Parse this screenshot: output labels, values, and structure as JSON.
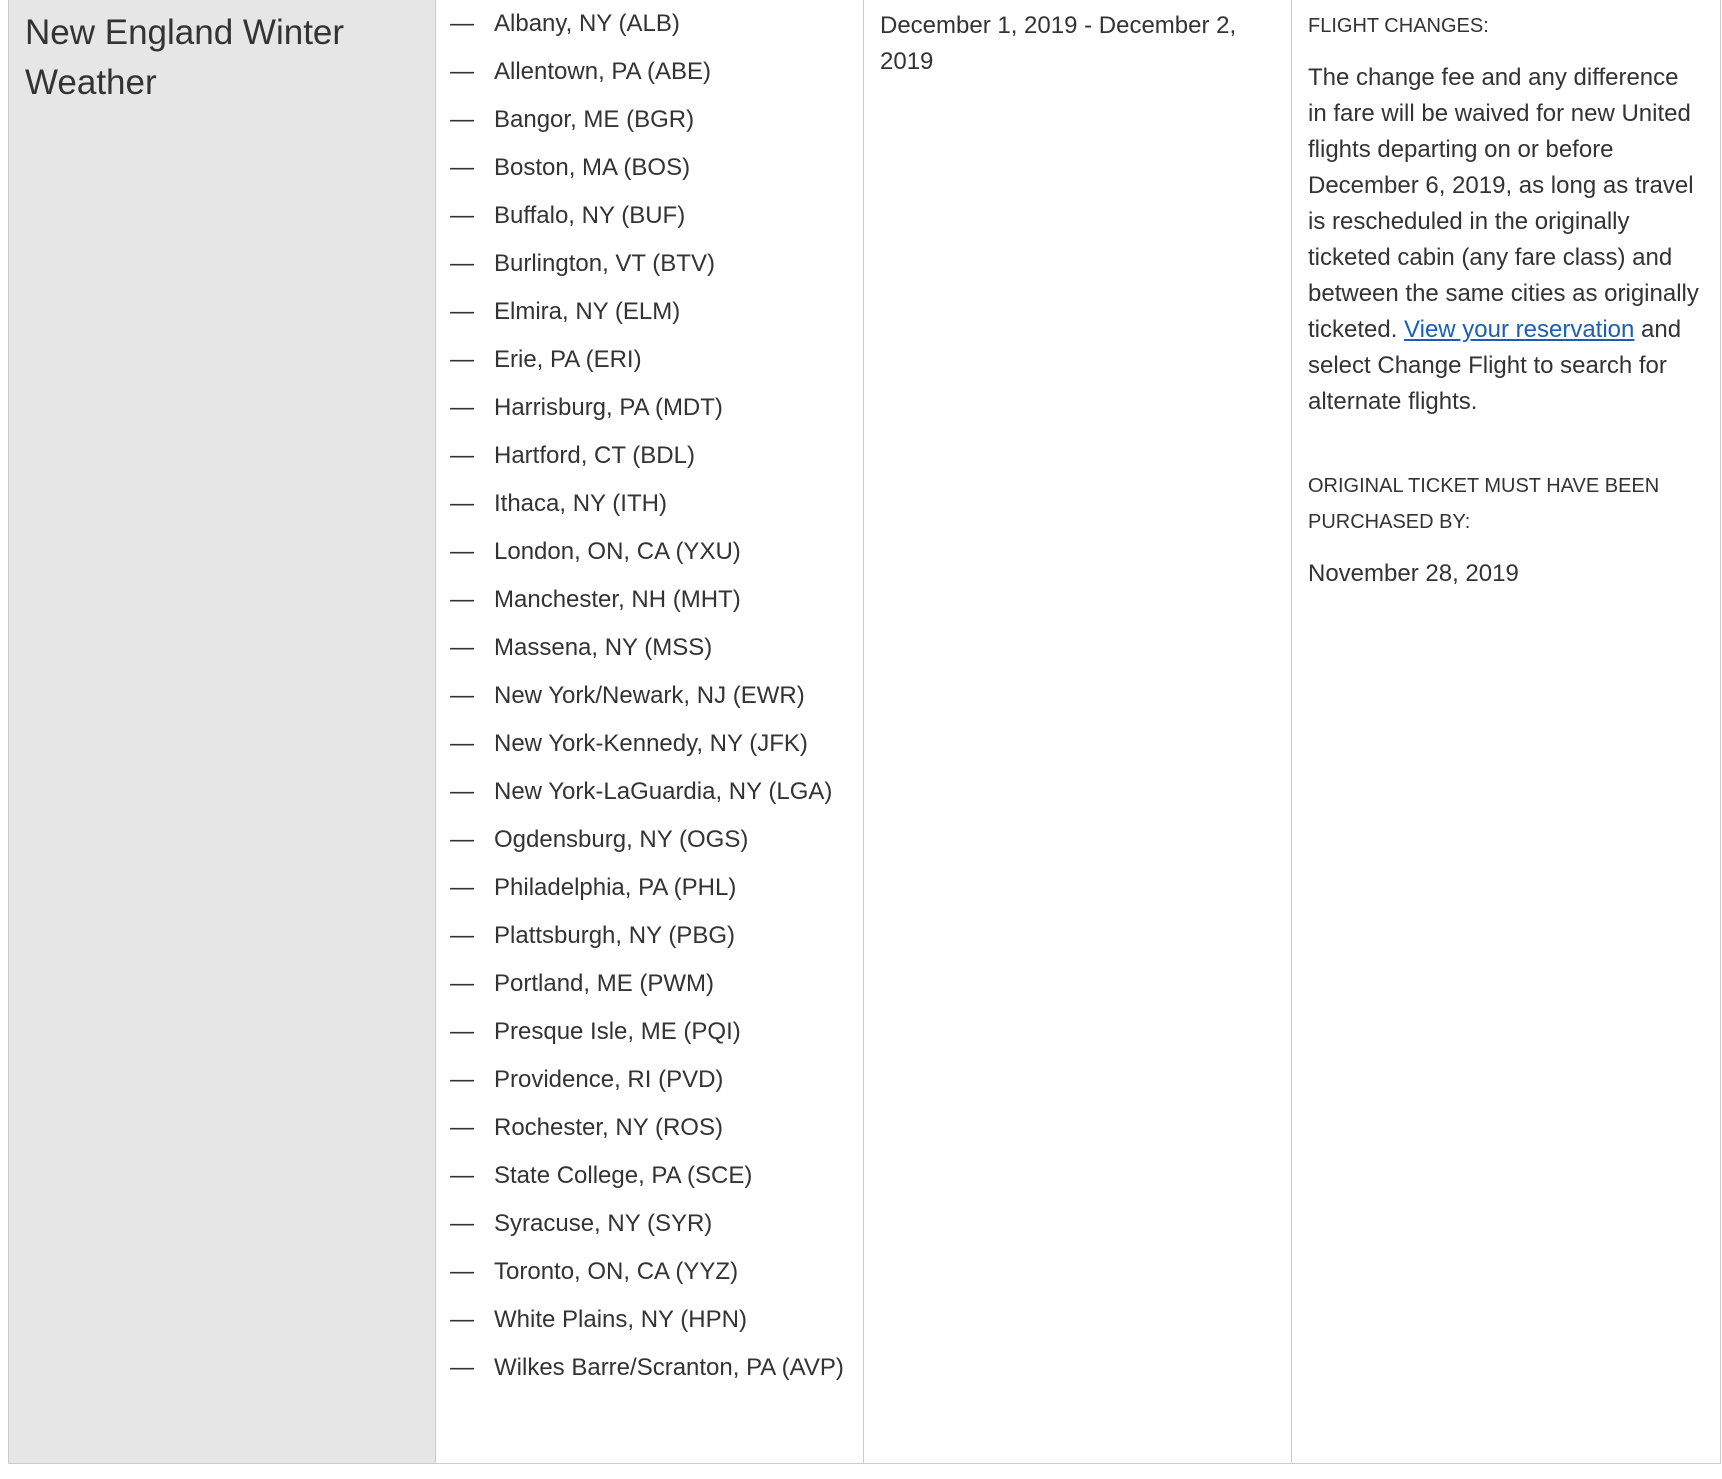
{
  "event": {
    "title": "New England Winter Weather"
  },
  "airports": [
    "Albany, NY (ALB)",
    "Allentown, PA (ABE)",
    "Bangor, ME (BGR)",
    "Boston, MA (BOS)",
    "Buffalo, NY (BUF)",
    "Burlington, VT (BTV)",
    "Elmira, NY (ELM)",
    "Erie, PA (ERI)",
    "Harrisburg, PA (MDT)",
    "Hartford, CT (BDL)",
    "Ithaca, NY (ITH)",
    "London, ON, CA (YXU)",
    "Manchester, NH (MHT)",
    "Massena, NY (MSS)",
    "New York/Newark, NJ (EWR)",
    "New York-Kennedy, NY (JFK)",
    "New York-LaGuardia, NY (LGA)",
    "Ogdensburg, NY (OGS)",
    "Philadelphia, PA (PHL)",
    "Plattsburgh, NY (PBG)",
    "Portland, ME (PWM)",
    "Presque Isle, ME (PQI)",
    "Providence, RI (PVD)",
    "Rochester, NY (ROS)",
    "State College, PA (SCE)",
    "Syracuse, NY (SYR)",
    "Toronto, ON, CA (YYZ)",
    "White Plains, NY (HPN)",
    "Wilkes Barre/Scranton, PA (AVP)"
  ],
  "list_marker": "—",
  "travel_dates": "December 1, 2019 - December 2, 2019",
  "details": {
    "flight_changes_heading": "FLIGHT CHANGES:",
    "flight_changes_before_link": "The change fee and any difference in fare will be waived for new United flights departing on or before December 6, 2019, as long as travel is rescheduled in the originally ticketed cabin (any fare class) and between the same cities as originally ticketed. ",
    "view_reservation_link": "View your reservation",
    "flight_changes_after_link": " and select Change Flight to search for alternate flights.",
    "purchase_heading": "ORIGINAL TICKET MUST HAVE BEEN PURCHASED BY:",
    "purchase_date": "November 28, 2019"
  },
  "colors": {
    "event_column_bg": "#e6e6e6",
    "text": "#333333",
    "link": "#1a5fb4",
    "border": "#cccccc"
  }
}
